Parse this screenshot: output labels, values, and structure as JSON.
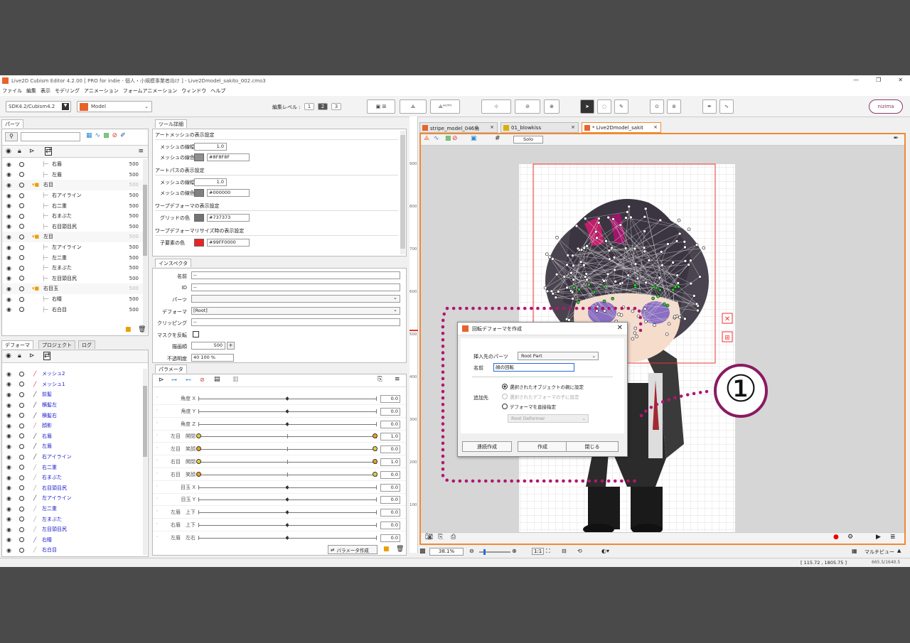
{
  "app": {
    "title": "Live2D Cubism Editor 4.2.00  [ PRO for indie - 個人・小規模事業者向け ] - Live2Dmodel_sakito_002.cmo3",
    "menu": [
      "ファイル",
      "編集",
      "表示",
      "モデリング",
      "アニメーション",
      "フォームアニメーション",
      "ウィンドウ",
      "ヘルプ"
    ],
    "sdk": "SDK4.2/Cubism4.2",
    "mode": "Model",
    "edit_level_label": "編集レベル :",
    "edit_levels": [
      "1",
      "2",
      "3"
    ],
    "user": "nizima",
    "window_controls": [
      "—",
      "❐",
      "✕"
    ]
  },
  "parts_panel": {
    "tab": "パーツ",
    "rows": [
      {
        "label": "右眉",
        "num": "500",
        "indent": 60,
        "kind": "item"
      },
      {
        "label": "左眉",
        "num": "500",
        "indent": 60,
        "kind": "item"
      },
      {
        "label": "右目",
        "num": "500",
        "indent": 48,
        "kind": "folder"
      },
      {
        "label": "右アイライン",
        "num": "500",
        "indent": 60,
        "kind": "item"
      },
      {
        "label": "右二重",
        "num": "500",
        "indent": 60,
        "kind": "item"
      },
      {
        "label": "右まぶた",
        "num": "500",
        "indent": 60,
        "kind": "item"
      },
      {
        "label": "右目頭目尻",
        "num": "500",
        "indent": 60,
        "kind": "item"
      },
      {
        "label": "左目",
        "num": "500",
        "indent": 48,
        "kind": "folder"
      },
      {
        "label": "左アイライン",
        "num": "500",
        "indent": 60,
        "kind": "item"
      },
      {
        "label": "左二重",
        "num": "500",
        "indent": 60,
        "kind": "item"
      },
      {
        "label": "左まぶた",
        "num": "500",
        "indent": 60,
        "kind": "item"
      },
      {
        "label": "左目頭目尻",
        "num": "500",
        "indent": 60,
        "kind": "item"
      },
      {
        "label": "右目玉",
        "num": "500",
        "indent": 48,
        "kind": "folder"
      },
      {
        "label": "右瞳",
        "num": "500",
        "indent": 60,
        "kind": "item"
      },
      {
        "label": "右白目",
        "num": "500",
        "indent": 60,
        "kind": "item"
      }
    ]
  },
  "deformer_panel": {
    "tabs": [
      "デフォーマ",
      "プロジェクト",
      "ログ"
    ],
    "rows": [
      "メッシュ2",
      "メッシュ1",
      "前髪",
      "横髪左",
      "横髪右",
      "顔影",
      "右眉",
      "左眉",
      "右アイライン",
      "右二重",
      "右まぶた",
      "右目頭目尻",
      "左アイライン",
      "左二重",
      "左まぶた",
      "左目頭目尻",
      "右瞳",
      "右白目"
    ]
  },
  "tool_detail": {
    "tab": "ツール詳細",
    "sections": [
      {
        "title": "アートメッシュの表示設定",
        "rows": [
          {
            "label": "メッシュの線幅",
            "value": "1.0"
          },
          {
            "label": "メッシュの線色",
            "value": "#8F8F8F",
            "color": "#8f8f8f"
          }
        ]
      },
      {
        "title": "アートパスの表示設定",
        "rows": [
          {
            "label": "メッシュの線幅",
            "value": "1.0"
          },
          {
            "label": "メッシュの線色",
            "value": "#000000",
            "color": "#808080"
          }
        ]
      },
      {
        "title": "ワープデフォーマの表示設定",
        "rows": [
          {
            "label": "グリッドの色",
            "value": "#737373",
            "color": "#737373"
          }
        ]
      },
      {
        "title": "ワープデフォーマリサイズ時の表示設定",
        "rows": [
          {
            "label": "子要素の色",
            "value": "#99FF0000",
            "color": "#ee2222"
          }
        ]
      }
    ]
  },
  "inspector": {
    "tab": "インスペクタ",
    "rows": [
      {
        "label": "名前",
        "value": "--"
      },
      {
        "label": "ID",
        "value": "--"
      },
      {
        "label": "パーツ",
        "value": ""
      },
      {
        "label": "デフォーマ",
        "value": "[Root]"
      },
      {
        "label": "クリッピング",
        "value": "--"
      },
      {
        "label": "マスクを反転",
        "value": ""
      },
      {
        "label": "描画順",
        "value": "500"
      },
      {
        "label": "不透明度",
        "value": "40  100 %"
      }
    ]
  },
  "parameters": {
    "tab": "パラメータ",
    "create_label": "パラメータ作成",
    "rows": [
      {
        "label": "角度 X",
        "value": "0.0",
        "kind": "center"
      },
      {
        "label": "角度 Y",
        "value": "0.0",
        "kind": "center"
      },
      {
        "label": "角度 Z",
        "value": "0.0",
        "kind": "center"
      },
      {
        "label": "左目　開閉",
        "value": "1.0",
        "kind": "end"
      },
      {
        "label": "左目　笑顔",
        "value": "0.0",
        "kind": "start"
      },
      {
        "label": "右目　開閉",
        "value": "1.0",
        "kind": "end"
      },
      {
        "label": "右目　笑顔",
        "value": "0.0",
        "kind": "start"
      },
      {
        "label": "目玉 X",
        "value": "0.0",
        "kind": "center"
      },
      {
        "label": "目玉 Y",
        "value": "0.0",
        "kind": "center"
      },
      {
        "label": "左眉　上下",
        "value": "0.0",
        "kind": "center"
      },
      {
        "label": "右眉　上下",
        "value": "0.0",
        "kind": "center"
      },
      {
        "label": "左眉　左右",
        "value": "0.0",
        "kind": "center"
      }
    ]
  },
  "viewport": {
    "tabs": [
      {
        "label": "stripe_model_046角",
        "active": false
      },
      {
        "label": "01_blowkiss",
        "active": false
      },
      {
        "label": "* Live2Dmodel_sakit",
        "active": true
      }
    ],
    "solo": "Solo",
    "ruler": [
      "900",
      "800",
      "700",
      "600",
      "500",
      "400",
      "300",
      "200",
      "100"
    ],
    "zoom": "38.1%",
    "preview": "マルチビュー",
    "coords": "[  115.72  ,  1805.75  ]",
    "size": "665.5/1640.5",
    "annotation": "①",
    "one_to_one": "1:1"
  },
  "dialog": {
    "title": "回転デフォーマを作成",
    "insert_label": "挿入先のパーツ",
    "insert_value": "Root Part",
    "name_label": "名前",
    "name_value": "顔の回転",
    "add_label": "追加先",
    "radios": [
      {
        "label": "選択されたオブジェクトの親に設定",
        "checked": true,
        "enabled": true
      },
      {
        "label": "選択されたデフォーマの子に設定",
        "checked": false,
        "enabled": false
      },
      {
        "label": "デフォーマを直接指定",
        "checked": false,
        "enabled": true
      }
    ],
    "deformer_select": "Root Deformer",
    "buttons": [
      "連続作成",
      "作成",
      "閉じる"
    ]
  }
}
